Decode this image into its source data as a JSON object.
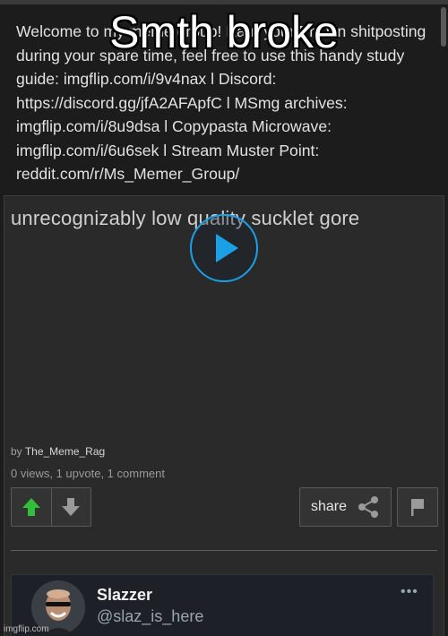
{
  "group_description": "Welcome to my meme group! Earn your PhD in shitposting during your spare time, feel free to use this handy study guide: imgflip.com/i/9v4nax l Discord: https://discord.gg/jfA2AFApfC l MSmg archives: imgflip.com/i/8u9dsa l Copypasta Microwave: imgflip.com/i/6u6sek l Stream Muster Point: reddit.com/r/Ms_Memer_Group/",
  "meme_caption": "Smth broke",
  "post": {
    "title": "unrecognizably low quality sucklet gore",
    "by_label": "by",
    "author": "The_Meme_Rag",
    "stats": "0 views, 1 upvote, 1 comment"
  },
  "actions": {
    "share_label": "share"
  },
  "embed": {
    "name": "Slazzer",
    "handle": "@slaz_is_here",
    "menu": "•••"
  },
  "watermark": "imgflip.com",
  "colors": {
    "accent_blue": "#1aa0e6",
    "upvote_green": "#2fbf3a",
    "background": "#1c1c1c",
    "card": "#2a2a2a"
  }
}
